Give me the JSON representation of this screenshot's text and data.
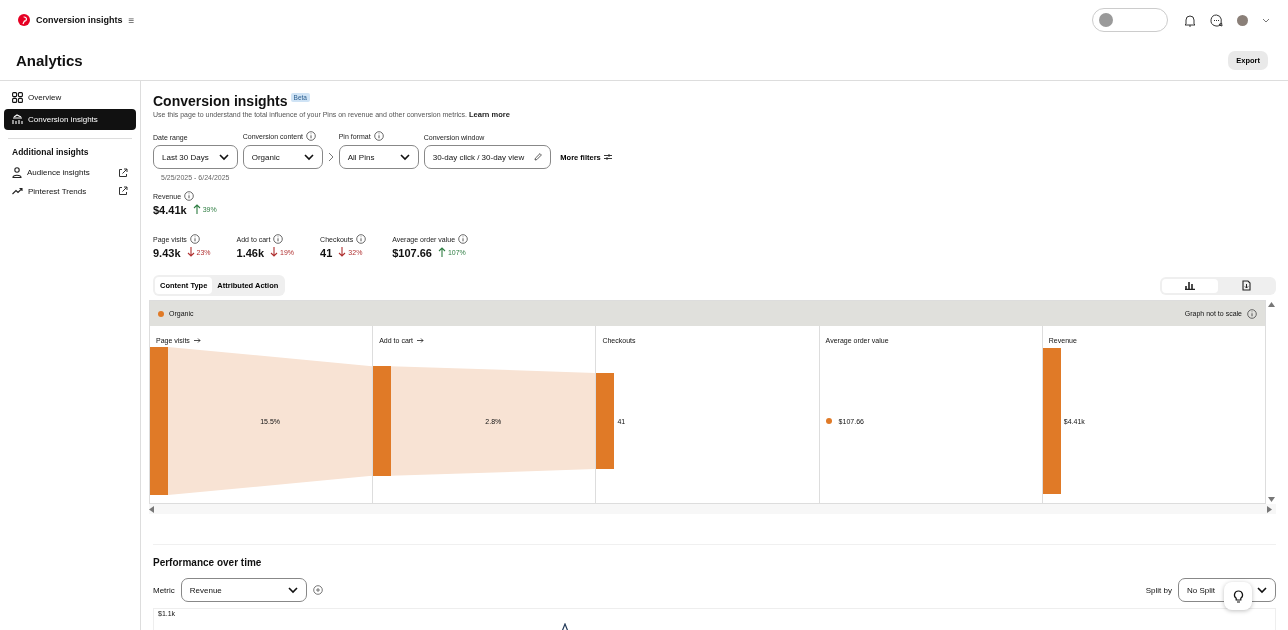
{
  "header": {
    "title": "Conversion insights",
    "menu_glyph": "≡"
  },
  "page": {
    "title": "Analytics",
    "export": "Export"
  },
  "sidebar": {
    "items": [
      {
        "label": "Overview",
        "selected": false
      },
      {
        "label": "Conversion insights",
        "selected": true
      }
    ],
    "section": "Additional insights",
    "links": [
      {
        "label": "Audience insights"
      },
      {
        "label": "Pinterest Trends"
      }
    ]
  },
  "main": {
    "title": "Conversion insights",
    "badge": "Beta",
    "description": "Use this page to understand the total influence of your Pins on revenue and other conversion metrics.",
    "learn_more": "Learn more",
    "filters": [
      {
        "label": "Date range",
        "info": false,
        "value": "Last 30 Days",
        "kind": "dropdown"
      },
      {
        "label": "Conversion content",
        "info": true,
        "value": "Organic",
        "kind": "dropdown"
      },
      {
        "label": "Pin format",
        "info": true,
        "value": "All Pins",
        "kind": "dropdown"
      },
      {
        "label": "Conversion window",
        "info": false,
        "value": "30-day click / 30-day view",
        "kind": "edit"
      }
    ],
    "more_filters": "More filters",
    "date_span": "5/25/2025 - 6/24/2025",
    "revenue": {
      "label": "Revenue",
      "value": "$4.41k",
      "change": "39%",
      "kind": "up"
    },
    "metrics": [
      {
        "label": "Page visits",
        "value": "9.43k",
        "change": "23%",
        "kind": "down"
      },
      {
        "label": "Add to cart",
        "value": "1.46k",
        "change": "19%",
        "kind": "down"
      },
      {
        "label": "Checkouts",
        "value": "41",
        "change": "32%",
        "kind": "down"
      },
      {
        "label": "Average order value",
        "value": "$107.66",
        "change": "107%",
        "kind": "up"
      }
    ],
    "tabs": [
      {
        "label": "Content Type",
        "selected": true
      },
      {
        "label": "Attributed Action",
        "selected": false
      }
    ],
    "view_toggle": [
      {
        "selected": true
      },
      {
        "selected": false
      }
    ],
    "funnel": {
      "legend": {
        "label": "Organic",
        "color": "#e07a27"
      },
      "note": "Graph not to scale",
      "stages": [
        {
          "label": "Page visits",
          "arrow": true,
          "kind": "bar",
          "flow": "15.5%"
        },
        {
          "label": "Add to cart",
          "arrow": true,
          "kind": "bar",
          "flow": "2.8%"
        },
        {
          "label": "Checkouts",
          "arrow": false,
          "kind": "bar",
          "value": "41"
        },
        {
          "label": "Average order value",
          "arrow": false,
          "kind": "dot",
          "value": "$107.66"
        },
        {
          "label": "Revenue",
          "arrow": false,
          "kind": "bar",
          "value": "$4.41k"
        }
      ]
    },
    "performance": {
      "title": "Performance over time",
      "metric_label": "Metric",
      "metric": "Revenue",
      "split_label": "Split by",
      "split": "No Split",
      "y_top": "$1.1k"
    }
  }
}
